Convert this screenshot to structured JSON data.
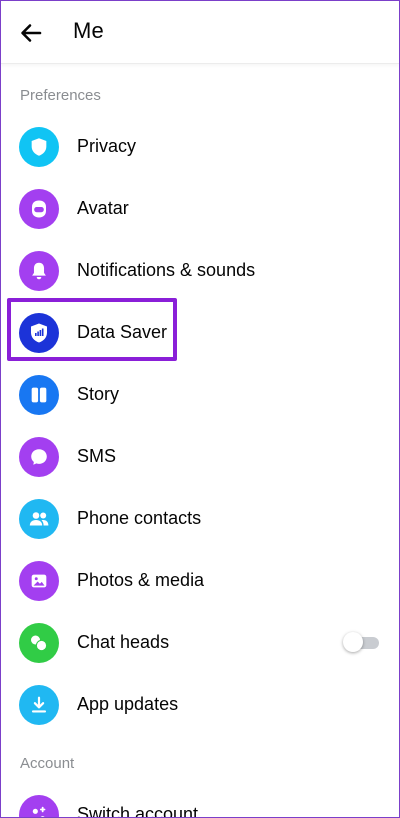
{
  "header": {
    "back_icon": "arrow-left-icon",
    "title": "Me"
  },
  "sections": {
    "preferences": "Preferences",
    "account": "Account"
  },
  "items": [
    {
      "label": "Privacy",
      "icon": "shield-icon",
      "color": "#10c4f4"
    },
    {
      "label": "Avatar",
      "icon": "avatar-face-icon",
      "color": "#a33ff0"
    },
    {
      "label": "Notifications & sounds",
      "icon": "bell-icon",
      "color": "#a33ff0"
    },
    {
      "label": "Data Saver",
      "icon": "data-saver-shield-icon",
      "color": "#1c33d8"
    },
    {
      "label": "Story",
      "icon": "story-icon",
      "color": "#1877f2"
    },
    {
      "label": "SMS",
      "icon": "chat-bubble-icon",
      "color": "#a33ff0"
    },
    {
      "label": "Phone contacts",
      "icon": "people-icon",
      "color": "#20b8f2"
    },
    {
      "label": "Photos & media",
      "icon": "photo-icon",
      "color": "#a33ff0"
    },
    {
      "label": "Chat heads",
      "icon": "chat-heads-icon",
      "color": "#31cc46"
    },
    {
      "label": "App updates",
      "icon": "download-icon",
      "color": "#20b8f2"
    },
    {
      "label": "Switch account",
      "icon": "switch-account-icon",
      "color": "#a33ff0"
    }
  ],
  "chat_heads_toggle": {
    "state": "off"
  },
  "highlight_color": "#8a1fd8"
}
